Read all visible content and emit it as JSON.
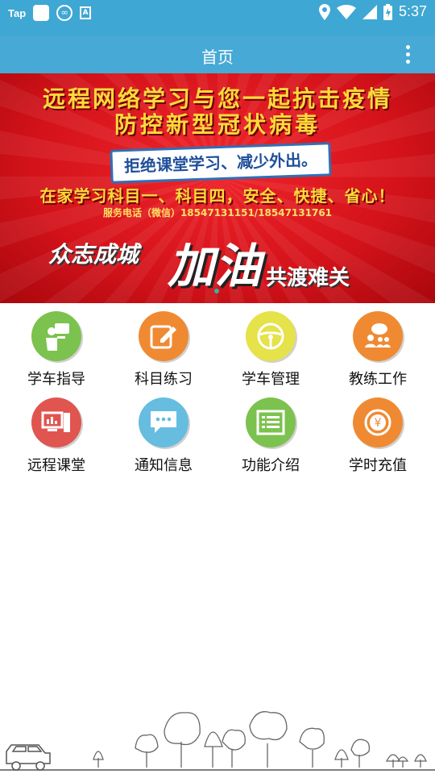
{
  "status_bar": {
    "app_indicator": "Tap",
    "time": "5:37"
  },
  "app_bar": {
    "title": "首页"
  },
  "banner": {
    "line1": "远程网络学习与您一起抗击疫情",
    "line2": "防控新型冠状病毒",
    "tag": "拒绝课堂学习、减少外出。",
    "line3": "在家学习科目一、科目四，安全、快捷、省心！",
    "line4": "服务电话（微信）18547131151/18547131761",
    "slogan_left": "众志成城",
    "slogan_brush": "加油",
    "slogan_right": "共渡难关"
  },
  "menu": [
    {
      "label": "学车指导",
      "icon": "teacher-icon",
      "color": "#7cc24e"
    },
    {
      "label": "科目练习",
      "icon": "edit-icon",
      "color": "#ef8a33"
    },
    {
      "label": "学车管理",
      "icon": "steering-wheel-icon",
      "color": "#e5e24a"
    },
    {
      "label": "教练工作",
      "icon": "group-chat-icon",
      "color": "#ef8a33"
    },
    {
      "label": "远程课堂",
      "icon": "computer-icon",
      "color": "#e0554f"
    },
    {
      "label": "通知信息",
      "icon": "message-icon",
      "color": "#66bde0"
    },
    {
      "label": "功能介绍",
      "icon": "list-icon",
      "color": "#7cc24e"
    },
    {
      "label": "学时充值",
      "icon": "yen-coin-icon",
      "color": "#ef8a33"
    }
  ]
}
